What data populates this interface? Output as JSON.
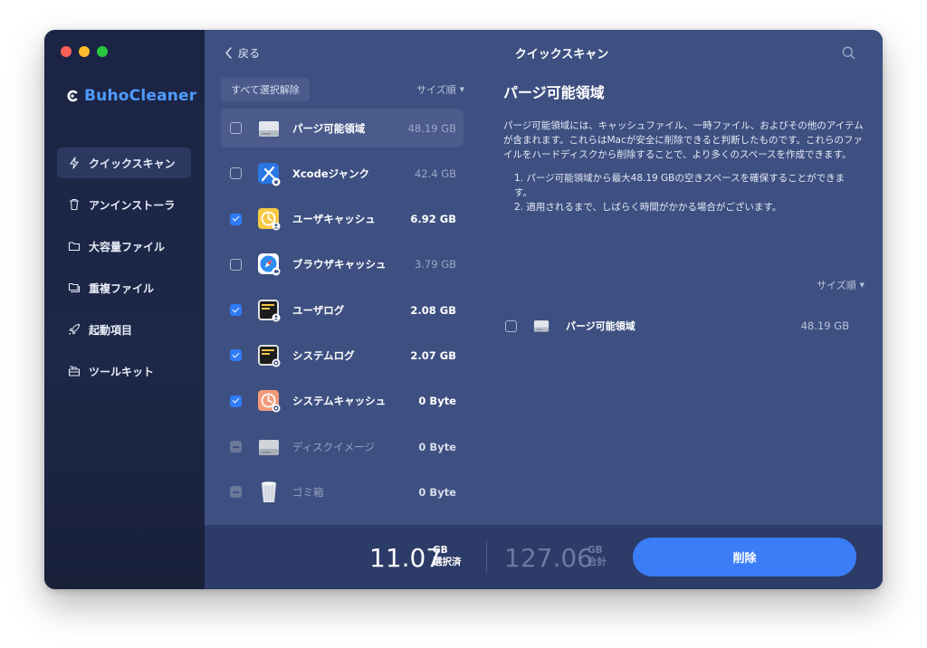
{
  "window": {
    "traffic_lights": {
      "close": "#fe5f57",
      "minimize": "#febc2e",
      "zoom": "#28c840"
    }
  },
  "sidebar": {
    "brand": "BuhoCleaner",
    "brand_color": "#4f9cff",
    "items": [
      {
        "label": "クイックスキャン",
        "icon": "lightning-icon",
        "active": true
      },
      {
        "label": "アンインストーラ",
        "icon": "trash-icon",
        "active": false
      },
      {
        "label": "大容量ファイル",
        "icon": "folder-icon",
        "active": false
      },
      {
        "label": "重複ファイル",
        "icon": "duplicate-folder-icon",
        "active": false
      },
      {
        "label": "起動項目",
        "icon": "rocket-icon",
        "active": false
      },
      {
        "label": "ツールキット",
        "icon": "toolkit-icon",
        "active": false
      }
    ]
  },
  "header": {
    "back_label": "戻る",
    "title": "クイックスキャン",
    "search_icon": "search-icon"
  },
  "list": {
    "deselect_all": "すべて選択解除",
    "sort_label": "サイズ順",
    "items": [
      {
        "name": "パージ可能領域",
        "size": "48.19 GB",
        "state": "unchecked",
        "icon": "drive-icon"
      },
      {
        "name": "Xcodeジャンク",
        "size": "42.4 GB",
        "state": "unchecked",
        "icon": "xcode-icon"
      },
      {
        "name": "ユーザキャッシュ",
        "size": "6.92 GB",
        "state": "checked",
        "icon": "user-cache-icon"
      },
      {
        "name": "ブラウザキャッシュ",
        "size": "3.79 GB",
        "state": "unchecked",
        "icon": "safari-icon"
      },
      {
        "name": "ユーザログ",
        "size": "2.08 GB",
        "state": "checked",
        "icon": "user-log-icon"
      },
      {
        "name": "システムログ",
        "size": "2.07 GB",
        "state": "checked",
        "icon": "system-log-icon"
      },
      {
        "name": "システムキャッシュ",
        "size": "0 Byte",
        "state": "checked",
        "icon": "system-cache-icon"
      },
      {
        "name": "ディスクイメージ",
        "size": "0 Byte",
        "state": "disabled",
        "icon": "disk-image-icon"
      },
      {
        "name": "ゴミ箱",
        "size": "0 Byte",
        "state": "disabled",
        "icon": "bin-icon"
      }
    ]
  },
  "detail": {
    "title": "パージ可能領域",
    "description": "パージ可能領域には、キャッシュファイル、一時ファイル、およびその他のアイテムが含まれます。これらはMacが安全に削除できると判断したものです。これらのファイルをハードディスクから削除することで、より多くのスペースを作成できます。",
    "notes": [
      "1. パージ可能領域から最大48.19 GBの空きスペースを確保することができます。",
      "2. 適用されるまで、しばらく時間がかかる場合がございます。"
    ],
    "sort_label": "サイズ順",
    "item": {
      "name": "パージ可能領域",
      "size": "48.19 GB"
    }
  },
  "footer": {
    "selected_value": "11.07",
    "selected_unit": "GB",
    "selected_label": "選択済",
    "total_value": "127.06",
    "total_unit": "GB",
    "total_label": "合計",
    "delete_label": "削除",
    "accent": "#3a7df6"
  }
}
